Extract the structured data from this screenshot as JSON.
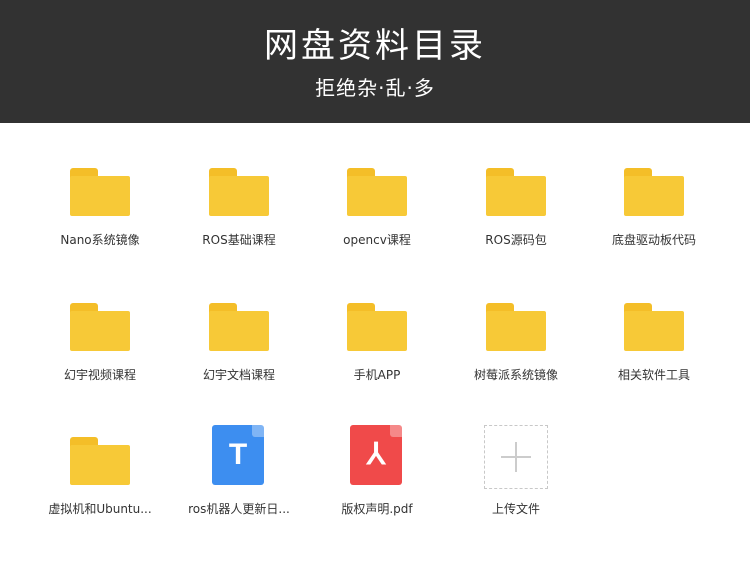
{
  "header": {
    "title": "网盘资料目录",
    "subtitle": "拒绝杂·乱·多"
  },
  "items": [
    {
      "label": "Nano系统镜像",
      "icon": "folder-icon"
    },
    {
      "label": "ROS基础课程",
      "icon": "folder-icon"
    },
    {
      "label": "opencv课程",
      "icon": "folder-icon"
    },
    {
      "label": "ROS源码包",
      "icon": "folder-icon"
    },
    {
      "label": "底盘驱动板代码",
      "icon": "folder-icon"
    },
    {
      "label": "幻宇视频课程",
      "icon": "folder-icon"
    },
    {
      "label": "幻宇文档课程",
      "icon": "folder-icon"
    },
    {
      "label": "手机APP",
      "icon": "folder-icon"
    },
    {
      "label": "树莓派系统镜像",
      "icon": "folder-icon"
    },
    {
      "label": "相关软件工具",
      "icon": "folder-icon"
    },
    {
      "label": "虚拟机和Ubuntu...",
      "icon": "folder-icon"
    },
    {
      "label": "ros机器人更新日...",
      "icon": "doc-file-icon",
      "letter": "T"
    },
    {
      "label": "版权声明.pdf",
      "icon": "pdf-file-icon",
      "letter": "⅄"
    },
    {
      "label": "上传文件",
      "icon": "plus-icon"
    }
  ],
  "colors": {
    "header_bg": "#323232",
    "folder": "#f7c937",
    "doc": "#3d8ef0",
    "pdf": "#f04a4a"
  }
}
